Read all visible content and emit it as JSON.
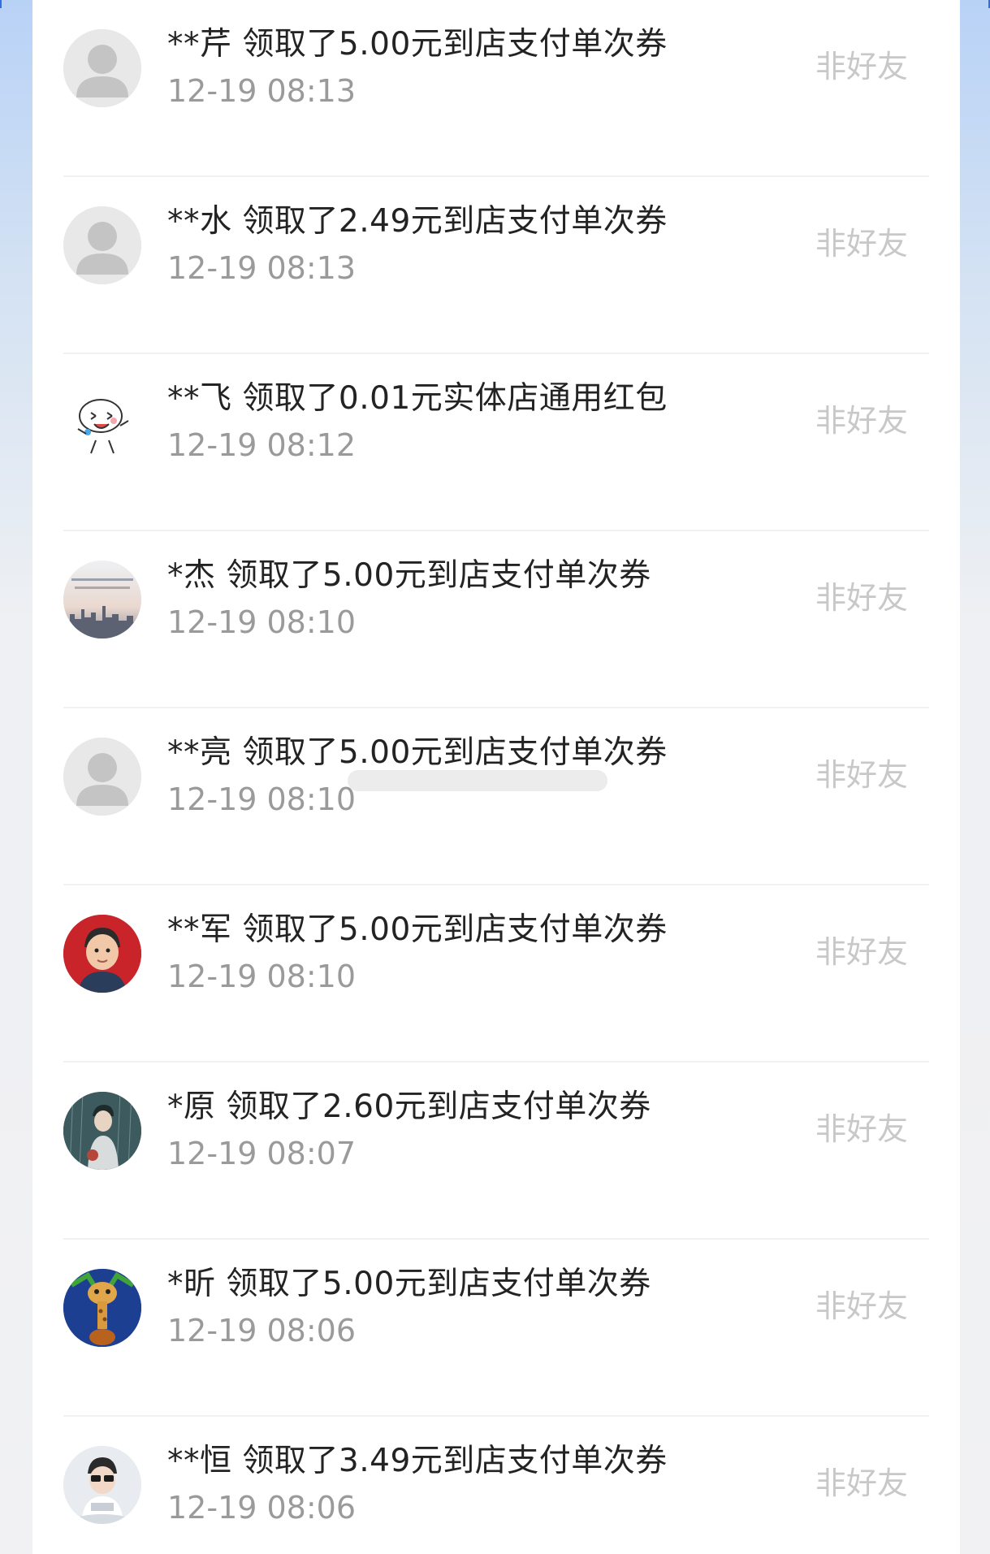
{
  "records": [
    {
      "name": "**芹",
      "action": "领取了5.00元到店支付单次券",
      "time": "12-19 08:13",
      "tag": "非好友",
      "avatar": "default-avatar-icon"
    },
    {
      "name": "**水",
      "action": "领取了2.49元到店支付单次券",
      "time": "12-19 08:13",
      "tag": "非好友",
      "avatar": "default-avatar-icon"
    },
    {
      "name": "**飞",
      "action": "领取了0.01元实体店通用红包",
      "time": "12-19 08:12",
      "tag": "非好友",
      "avatar": "cartoon-avatar"
    },
    {
      "name": "*杰",
      "action": "领取了5.00元到店支付单次券",
      "time": "12-19 08:10",
      "tag": "非好友",
      "avatar": "city-skyline-avatar"
    },
    {
      "name": "**亮",
      "action": "领取了5.00元到店支付单次券",
      "time": "12-19 08:10",
      "tag": "非好友",
      "avatar": "default-avatar-icon"
    },
    {
      "name": "**军",
      "action": "领取了5.00元到店支付单次券",
      "time": "12-19 08:10",
      "tag": "非好友",
      "avatar": "boy-red-avatar"
    },
    {
      "name": "*原",
      "action": "领取了2.60元到店支付单次券",
      "time": "12-19 08:07",
      "tag": "非好友",
      "avatar": "rain-illustration-avatar"
    },
    {
      "name": "*昕",
      "action": "领取了5.00元到店支付单次券",
      "time": "12-19 08:06",
      "tag": "非好友",
      "avatar": "giraffe-avatar"
    },
    {
      "name": "**恒",
      "action": "领取了3.49元到店支付单次券",
      "time": "12-19 08:06",
      "tag": "非好友",
      "avatar": "child-photo-avatar"
    }
  ]
}
